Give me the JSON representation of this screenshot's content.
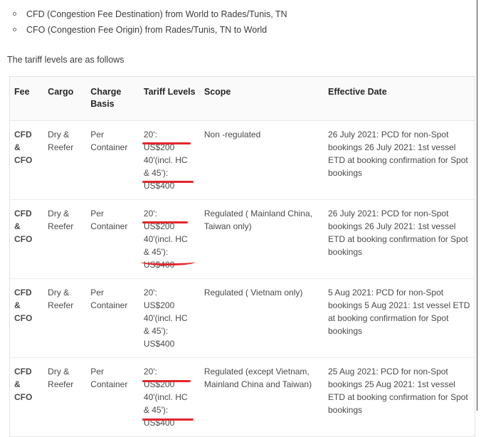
{
  "intro": {
    "bullets": [
      "CFD (Congestion Fee Destination) from World to Rades/Tunis, TN",
      "CFO (Congestion Fee Origin) from Rades/Tunis, TN to World"
    ],
    "lead": "The tariff levels are as follows"
  },
  "table": {
    "headers": [
      "Fee",
      "Cargo",
      "Charge Basis",
      "Tariff Levels",
      "Scope",
      "Effective Date"
    ],
    "rows": [
      {
        "fee": [
          "CFD",
          "&",
          "CFO"
        ],
        "cargo": "Dry & Reefer",
        "basis": "Per Container",
        "tariff": [
          "20':",
          "US$200",
          "40'(incl. HC",
          "& 45'):",
          "US$400"
        ],
        "scope": "Non -regulated",
        "date": "26 July 2021: PCD for non-Spot bookings 26 July 2021: 1st vessel ETD at booking confirmation for Spot bookings",
        "date_lines": [
          "26 July 2021: PCD for non-Spot",
          "bookings",
          "26 July 2021: 1st vessel ETD at",
          "booking confirmation for Spot",
          "bookings"
        ]
      },
      {
        "fee": [
          "CFD",
          "&",
          "CFO"
        ],
        "cargo": "Dry & Reefer",
        "basis": "Per Container",
        "tariff": [
          "20':",
          "US$200",
          "40'(incl. HC",
          "& 45'):",
          "US$400"
        ],
        "scope": "Regulated ( Mainland China, Taiwan only)",
        "date_lines": [
          "26 July 2021: PCD for non-Spot",
          "bookings",
          "26 July 2021: 1st vessel ETD at",
          "booking confirmation for Spot",
          "bookings"
        ]
      },
      {
        "fee": [
          "CFD",
          "&",
          "CFO"
        ],
        "cargo": "Dry & Reefer",
        "basis": "Per Container",
        "tariff": [
          "20':",
          "US$200",
          "40'(incl. HC",
          "& 45'):",
          "US$400"
        ],
        "scope": "Regulated ( Vietnam only)",
        "date_lines": [
          "5 Aug 2021: PCD for non-Spot",
          "bookings",
          "5 Aug 2021: 1st vessel ETD at",
          "booking confirmation for Spot",
          "bookings"
        ]
      },
      {
        "fee": [
          "CFD",
          "&",
          "CFO"
        ],
        "cargo": "Dry & Reefer",
        "basis": "Per Container",
        "tariff": [
          "20':",
          "US$200",
          "40'(incl. HC",
          "& 45'):",
          "US$400"
        ],
        "scope": "Regulated (except Vietnam, Mainland China and Taiwan)",
        "date_lines": [
          "25 Aug 2021: PCD for non-Spot",
          "bookings",
          "25 Aug 2021: 1st vessel ETD at",
          "booking confirmation for Spot",
          "bookings"
        ]
      }
    ]
  },
  "annotations": {
    "color": "#e4262c",
    "description": "Red hand-drawn underlines beneath US$200 and US$400 in rows 1, 2 and 4"
  }
}
